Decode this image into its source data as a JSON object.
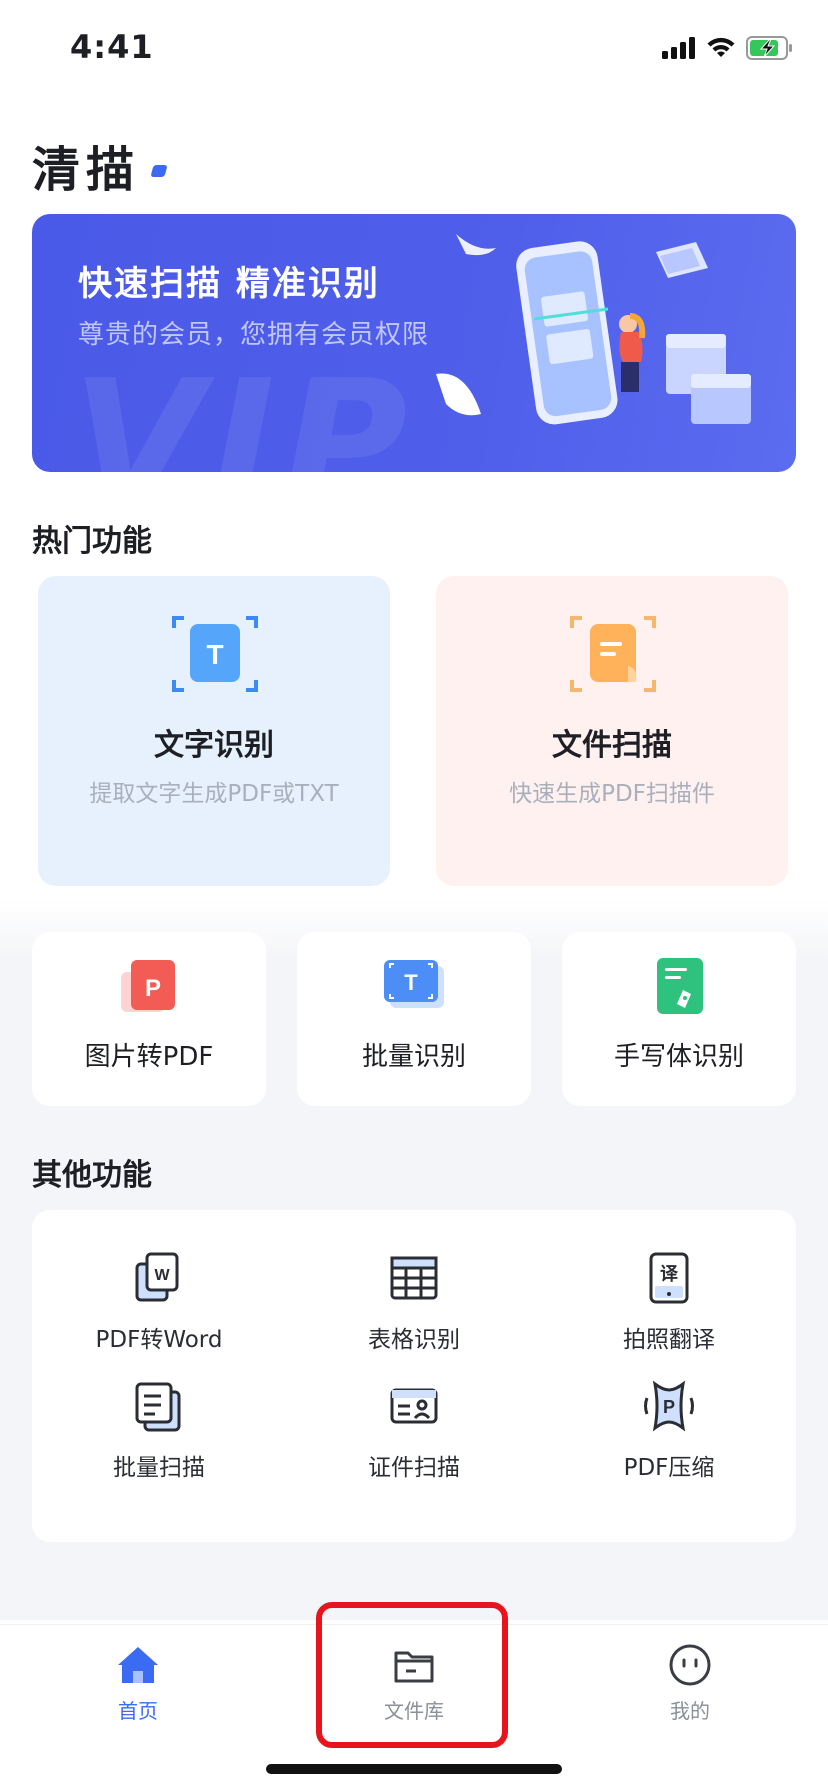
{
  "status_bar": {
    "time": "4:41"
  },
  "app_title": "清描",
  "banner": {
    "title": "快速扫描  精准识别",
    "subtitle": "尊贵的会员，您拥有会员权限",
    "watermark": "VIP"
  },
  "hot_section": {
    "title": "热门功能",
    "cards": [
      {
        "name": "文字识别",
        "desc": "提取文字生成PDF或TXT"
      },
      {
        "name": "文件扫描",
        "desc": "快速生成PDF扫描件"
      }
    ]
  },
  "quick_tools": [
    {
      "label": "图片转PDF"
    },
    {
      "label": "批量识别"
    },
    {
      "label": "手写体识别"
    }
  ],
  "other_section": {
    "title": "其他功能",
    "items": [
      {
        "label": "PDF转Word",
        "icon": "word-doc-icon"
      },
      {
        "label": "表格识别",
        "icon": "table-icon"
      },
      {
        "label": "拍照翻译",
        "icon": "translate-icon"
      },
      {
        "label": "批量扫描",
        "icon": "batch-scan-icon"
      },
      {
        "label": "证件扫描",
        "icon": "id-card-icon"
      },
      {
        "label": "PDF压缩",
        "icon": "pdf-compress-icon"
      }
    ]
  },
  "tabbar": {
    "tabs": [
      {
        "label": "首页",
        "icon": "home-icon",
        "active": true
      },
      {
        "label": "文件库",
        "icon": "folder-icon",
        "active": false
      },
      {
        "label": "我的",
        "icon": "profile-face-icon",
        "active": false
      }
    ]
  },
  "colors": {
    "accent": "#3a6bf2",
    "banner": "#4f5fea",
    "highlight": "#e8141c"
  }
}
